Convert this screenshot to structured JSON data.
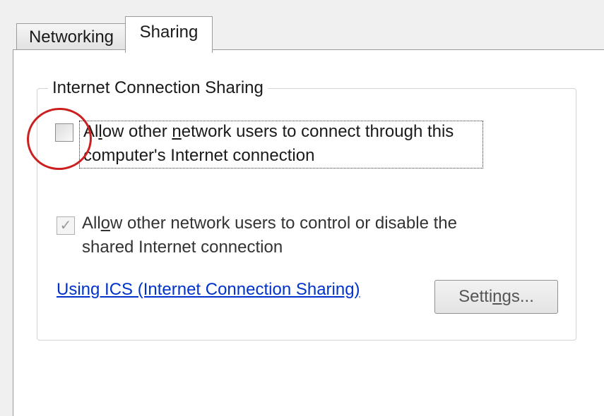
{
  "tabs": [
    {
      "label": "Networking",
      "active": false
    },
    {
      "label": "Sharing",
      "active": true
    }
  ],
  "group": {
    "title": "Internet Connection Sharing",
    "option_allow_connect": {
      "checked": false,
      "line1_pre": "Al",
      "line1_mnemonic": "l",
      "line1_mid": "ow other ",
      "line1_mnemonic2": "n",
      "line1_post": "etwork users to connect through this",
      "line2": "computer's Internet connection"
    },
    "option_allow_control": {
      "checked": true,
      "enabled": false,
      "line1_pre": "All",
      "line1_mnemonic": "o",
      "line1_post": "w other network users to control or disable the",
      "line2": "shared Internet connection"
    },
    "link_label": "Using ICS (Internet Connection Sharing)",
    "settings_pre": "Setti",
    "settings_mnemonic": "n",
    "settings_post": "gs..."
  },
  "colors": {
    "link": "#0033cc",
    "highlight_circle": "#cc2020"
  }
}
